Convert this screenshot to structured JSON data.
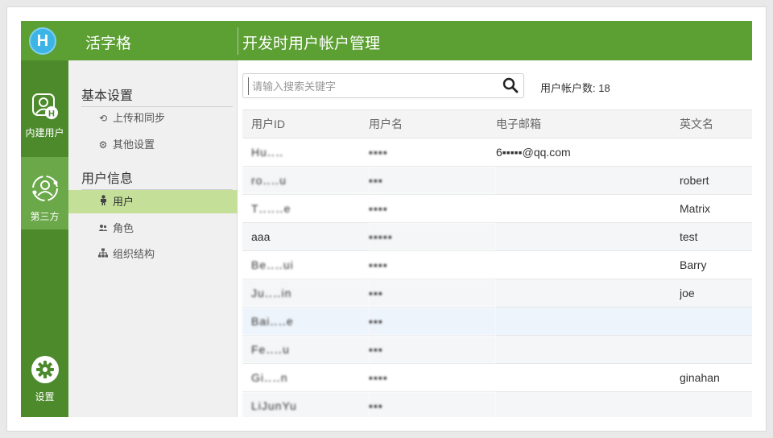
{
  "header": {
    "logo": "H",
    "brand": "活字格",
    "title": "开发时用户帐户管理"
  },
  "rail": {
    "builtin_label": "内建用户",
    "third_label": "第三方",
    "settings_label": "设置"
  },
  "subnav": {
    "basic_section": "基本设置",
    "upload_sync": "上传和同步",
    "other_settings": "其他设置",
    "user_section": "用户信息",
    "users": "用户",
    "roles": "角色",
    "org": "组织结构"
  },
  "search": {
    "placeholder": "请输入搜索关键字",
    "value": ""
  },
  "user_count": "用户帐户数: 18",
  "table": {
    "headers": [
      "用户ID",
      "用户名",
      "电子邮箱",
      "英文名"
    ],
    "rows": [
      [
        "Hu‥‥",
        "▪▪▪▪",
        "6▪▪▪▪▪@qq.com",
        ""
      ],
      [
        "ro‥‥u",
        "▪▪▪",
        "",
        "robert"
      ],
      [
        "T‥‥‥e",
        "▪▪▪▪",
        "",
        "Matrix"
      ],
      [
        "aaa",
        "▪▪▪▪▪",
        "",
        "test"
      ],
      [
        "Be‥‥ui",
        "▪▪▪▪",
        "",
        "Barry"
      ],
      [
        "Ju‥‥in",
        "▪▪▪",
        "",
        "joe"
      ],
      [
        "Bai‥‥e",
        "▪▪▪",
        "",
        ""
      ],
      [
        "Fe‥‥u",
        "▪▪▪",
        "",
        ""
      ],
      [
        "Gi‥‥n",
        "▪▪▪▪",
        "",
        "ginahan"
      ],
      [
        "LiJunYu",
        "▪▪▪",
        "",
        ""
      ]
    ]
  },
  "icons": {
    "logo": "h-logo-icon",
    "builtin": "user-h-icon",
    "third": "user-circle-icon",
    "settings": "gear-icon",
    "search": "search-icon"
  },
  "colors": {
    "header_green": "#5c9f33",
    "rail_green": "#4c8a2c",
    "active_nav": "#c3df98"
  }
}
